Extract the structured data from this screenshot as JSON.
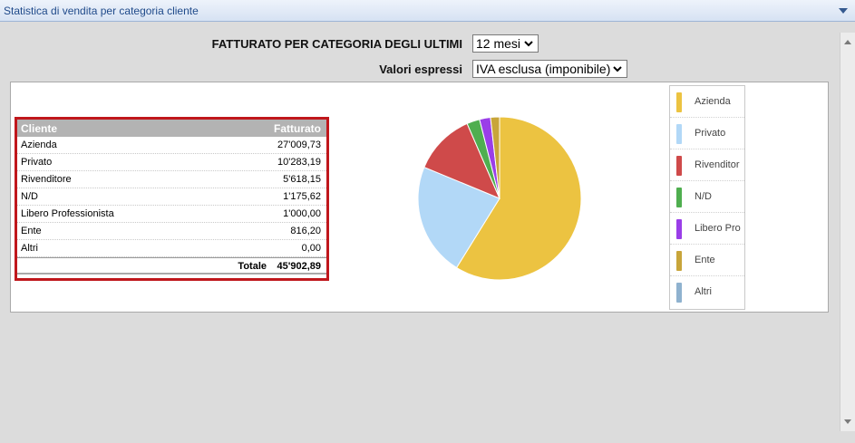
{
  "window": {
    "title": "Statistica di vendita per categoria cliente"
  },
  "filters": {
    "period_label": "FATTURATO PER CATEGORIA DEGLI ULTIMI",
    "period_value": "12 mesi",
    "values_label": "Valori espressi",
    "values_value": "IVA esclusa (imponibile)"
  },
  "table": {
    "col_cliente": "Cliente",
    "col_fatturato": "Fatturato",
    "rows": [
      {
        "cliente": "Azienda",
        "fatturato": "27'009,73"
      },
      {
        "cliente": "Privato",
        "fatturato": "10'283,19"
      },
      {
        "cliente": "Rivenditore",
        "fatturato": "5'618,15"
      },
      {
        "cliente": "N/D",
        "fatturato": "1'175,62"
      },
      {
        "cliente": "Libero Professionista",
        "fatturato": "1'000,00"
      },
      {
        "cliente": "Ente",
        "fatturato": "816,20"
      },
      {
        "cliente": "Altri",
        "fatturato": "0,00"
      }
    ],
    "total_label": "Totale",
    "total_value": "45'902,89"
  },
  "chart_data": {
    "type": "pie",
    "legend_position": "right",
    "slices": [
      {
        "name": "Azienda",
        "value": 27009.73,
        "color": "#ecc341"
      },
      {
        "name": "Privato",
        "value": 10283.19,
        "color": "#b2d8f7"
      },
      {
        "name": "Rivenditor",
        "value": 5618.15,
        "color": "#cf4a4a"
      },
      {
        "name": "N/D",
        "value": 1175.62,
        "color": "#4fae4f"
      },
      {
        "name": "Libero Pro",
        "value": 1000.0,
        "color": "#9a3ee8"
      },
      {
        "name": "Ente",
        "value": 816.2,
        "color": "#c8a53a"
      },
      {
        "name": "Altri",
        "value": 0.0,
        "color": "#8fb2cf"
      }
    ]
  }
}
